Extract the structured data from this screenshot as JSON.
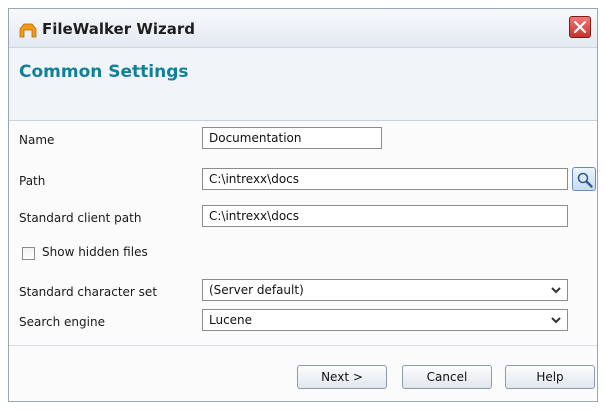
{
  "window": {
    "title": "FileWalker Wizard",
    "icon": "filewalker-icon",
    "close_icon": "close-icon"
  },
  "header": {
    "title": "Common Settings"
  },
  "form": {
    "name": {
      "label": "Name",
      "value": "Documentation"
    },
    "path": {
      "label": "Path",
      "value": "C:\\intrexx\\docs",
      "browse_icon": "search-icon"
    },
    "client_path": {
      "label": "Standard client path",
      "value": "C:\\intrexx\\docs"
    },
    "show_hidden": {
      "label": "Show hidden files",
      "checked": false
    },
    "charset": {
      "label": "Standard character set",
      "value": "(Server default)"
    },
    "engine": {
      "label": "Search engine",
      "value": "Lucene"
    }
  },
  "footer": {
    "next_label": "Next >",
    "cancel_label": "Cancel",
    "help_label": "Help"
  },
  "colors": {
    "section_title": "#13809a",
    "close_button": "#c8322e"
  }
}
